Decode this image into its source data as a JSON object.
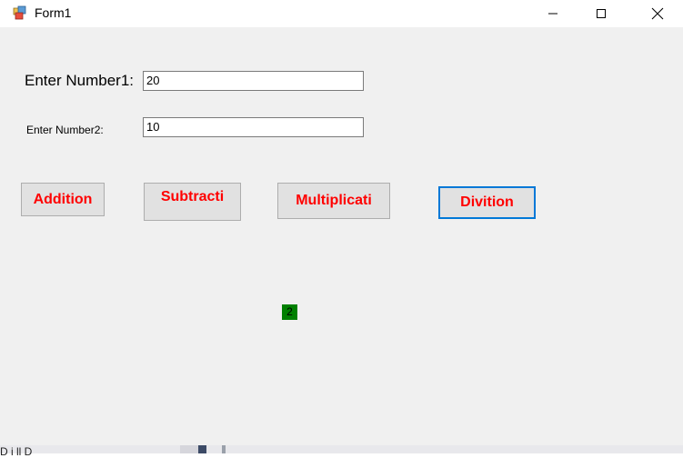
{
  "window": {
    "title": "Form1",
    "icon": "winforms-app-icon",
    "controls": {
      "minimize": "minimize-icon",
      "maximize": "maximize-icon",
      "close": "close-icon"
    }
  },
  "form": {
    "label1": "Enter Number1:",
    "input1_value": "20",
    "label2": "Enter Number2:",
    "input2_value": "10",
    "buttons": {
      "addition": "Addition",
      "subtraction": "Subtracti",
      "multiplication": "Multiplicati",
      "division": "Divition"
    },
    "result": "2"
  },
  "background": {
    "partial_text": "D   i  ll  D"
  },
  "colors": {
    "button_text": "#ff0000",
    "result_background": "#008000",
    "focus_border": "#0078d7",
    "form_background": "#f0f0f0"
  }
}
